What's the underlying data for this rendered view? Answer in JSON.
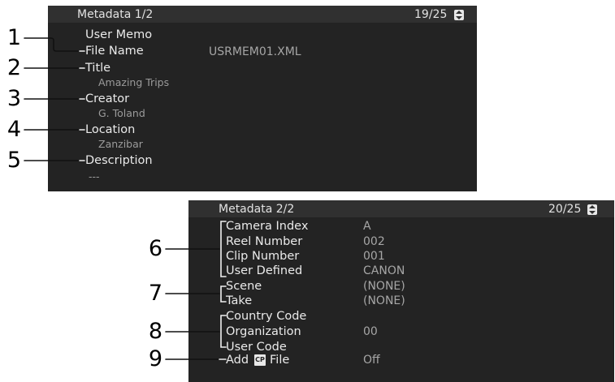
{
  "screen1": {
    "title": "Metadata 1/2",
    "page": "19/25",
    "group": "User Memo",
    "file_name_label": "File Name",
    "file_name_value": "USRMEM01.XML",
    "title_label": "Title",
    "title_value": "Amazing Trips",
    "creator_label": "Creator",
    "creator_value": "G. Toland",
    "location_label": "Location",
    "location_value": "Zanzibar",
    "description_label": "Description",
    "description_value": "---"
  },
  "screen2": {
    "title": "Metadata 2/2",
    "page": "20/25",
    "rows": [
      {
        "label": "Camera Index",
        "value": "A"
      },
      {
        "label": "Reel Number",
        "value": "002"
      },
      {
        "label": "Clip Number",
        "value": "001"
      },
      {
        "label": "User Defined",
        "value": "CANON"
      },
      {
        "label": "Scene",
        "value": "(NONE)"
      },
      {
        "label": "Take",
        "value": "(NONE)"
      },
      {
        "label": "Country Code",
        "value": ""
      },
      {
        "label": "Organization",
        "value": "00"
      },
      {
        "label": "User Code",
        "value": ""
      }
    ],
    "add_file_prefix": "Add",
    "add_file_icon": "CP",
    "add_file_suffix": "File",
    "add_file_value": "Off"
  },
  "callouts": [
    "1",
    "2",
    "3",
    "4",
    "5",
    "6",
    "7",
    "8",
    "9"
  ],
  "icons": {
    "page_scroll": "up-down-arrows-icon",
    "cp_badge": "cp-icon"
  }
}
